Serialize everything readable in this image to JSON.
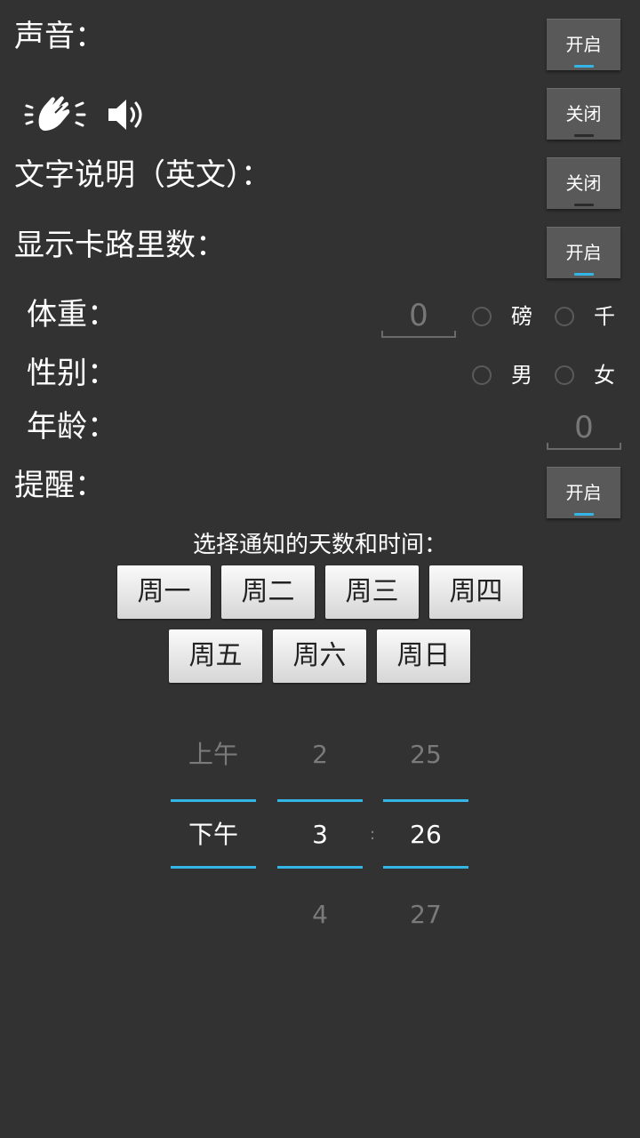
{
  "settings": {
    "sound_label": "声音：",
    "sound_toggle": "开启",
    "sound_icon_toggle": "关闭",
    "text_desc_label": "文字说明（英文）：",
    "text_desc_toggle": "关闭",
    "calories_label": "显示卡路里数：",
    "calories_toggle": "开启",
    "weight_label": "体重：",
    "weight_value": "0",
    "weight_unit_pound": "磅",
    "weight_unit_kg": "千",
    "gender_label": "性别：",
    "gender_male": "男",
    "gender_female": "女",
    "age_label": "年龄：",
    "age_value": "0",
    "reminder_label": "提醒：",
    "reminder_toggle": "开启"
  },
  "reminder": {
    "prompt": "选择通知的天数和时间：",
    "days": [
      "周一",
      "周二",
      "周三",
      "周四",
      "周五",
      "周六",
      "周日"
    ]
  },
  "time_picker": {
    "ampm": {
      "prev": "上午",
      "current": "下午",
      "next": ""
    },
    "hour": {
      "prev": "2",
      "current": "3",
      "next": "4"
    },
    "minute": {
      "prev": "25",
      "current": "26",
      "next": "27"
    },
    "separator": ":"
  },
  "colors": {
    "accent": "#33b5e5",
    "background": "#323232",
    "toggle": "#595959"
  }
}
